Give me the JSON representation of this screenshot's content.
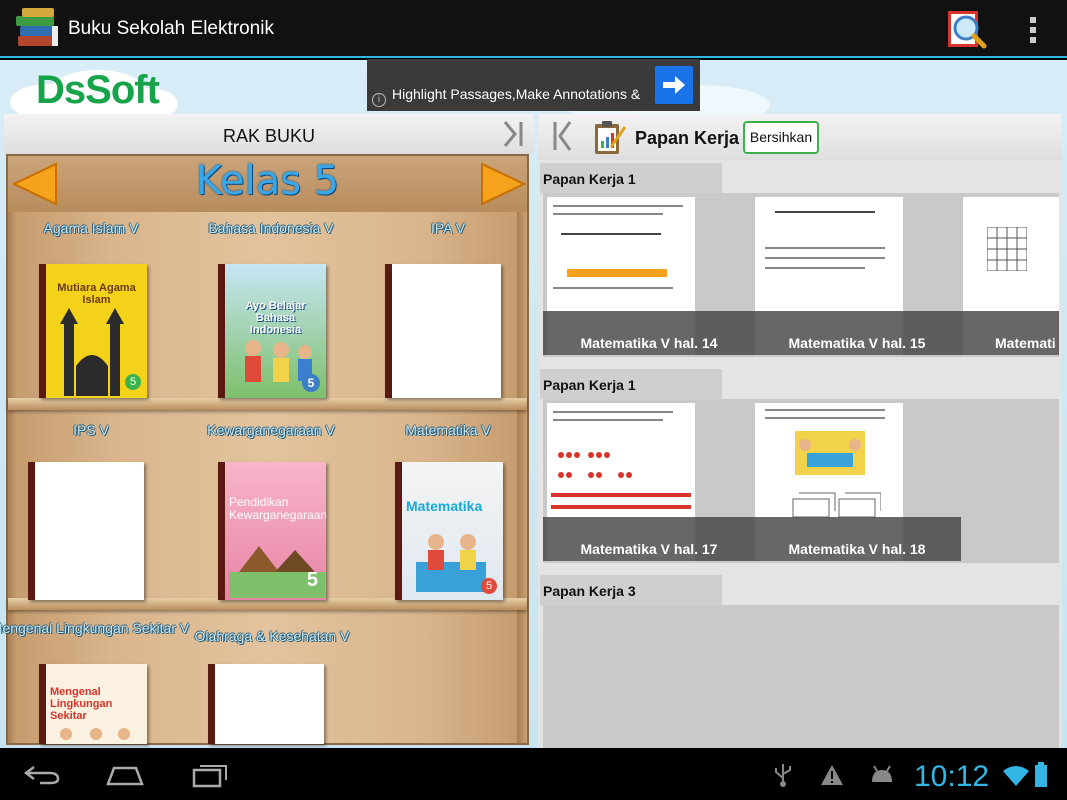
{
  "actionbar": {
    "title": "Buku Sekolah Elektronik",
    "icons": [
      "books-app-icon",
      "search-document-icon",
      "overflow-menu-icon"
    ]
  },
  "logo": {
    "text_a": "Ds",
    "text_b": "Soft"
  },
  "ad": {
    "text": "Highlight Passages,Make Annotations &",
    "info_symbol": "i"
  },
  "bookshelf": {
    "header": "RAK BUKU",
    "grade": "Kelas 5",
    "books": [
      {
        "label": "Agama Islam V",
        "cover_title": "Mutiara Agama Islam",
        "cover_badge": "5"
      },
      {
        "label": "Bahasa Indonesia V",
        "cover_title": "Bahasa Indonesia",
        "cover_pre": "Ayo Belajar",
        "cover_badge": "5"
      },
      {
        "label": "IPA V"
      },
      {
        "label": "IPS V"
      },
      {
        "label": "Kewarganegaraan V",
        "cover_title": "Pendidikan Kewarganegaraan",
        "cover_badge": "5"
      },
      {
        "label": "Matematika V",
        "cover_title": "Matematika",
        "cover_badge": "5"
      },
      {
        "label": "Mengenal Lingkungan Sekitar V",
        "cover_title": "Mengenal Lingkungan Sekitar"
      },
      {
        "label": "Olahraga & Kesehatan V"
      }
    ]
  },
  "workspace": {
    "title": "Papan Kerja",
    "clear_button": "Bersihkan",
    "boards": [
      {
        "label": "Papan Kerja 1",
        "pages": [
          "Matematika V hal. 14",
          "Matematika V hal. 15",
          "Matemati"
        ]
      },
      {
        "label": "Papan Kerja 1",
        "pages": [
          "Matematika V hal. 17",
          "Matematika V hal. 18"
        ]
      },
      {
        "label": "Papan Kerja 3",
        "pages": []
      }
    ]
  },
  "statusbar": {
    "time": "10:12"
  },
  "colors": {
    "accent": "#33b5e5",
    "clear_border": "#3bb34a",
    "logo_green": "#16a34a",
    "logo_blue": "#0b7fd1"
  }
}
